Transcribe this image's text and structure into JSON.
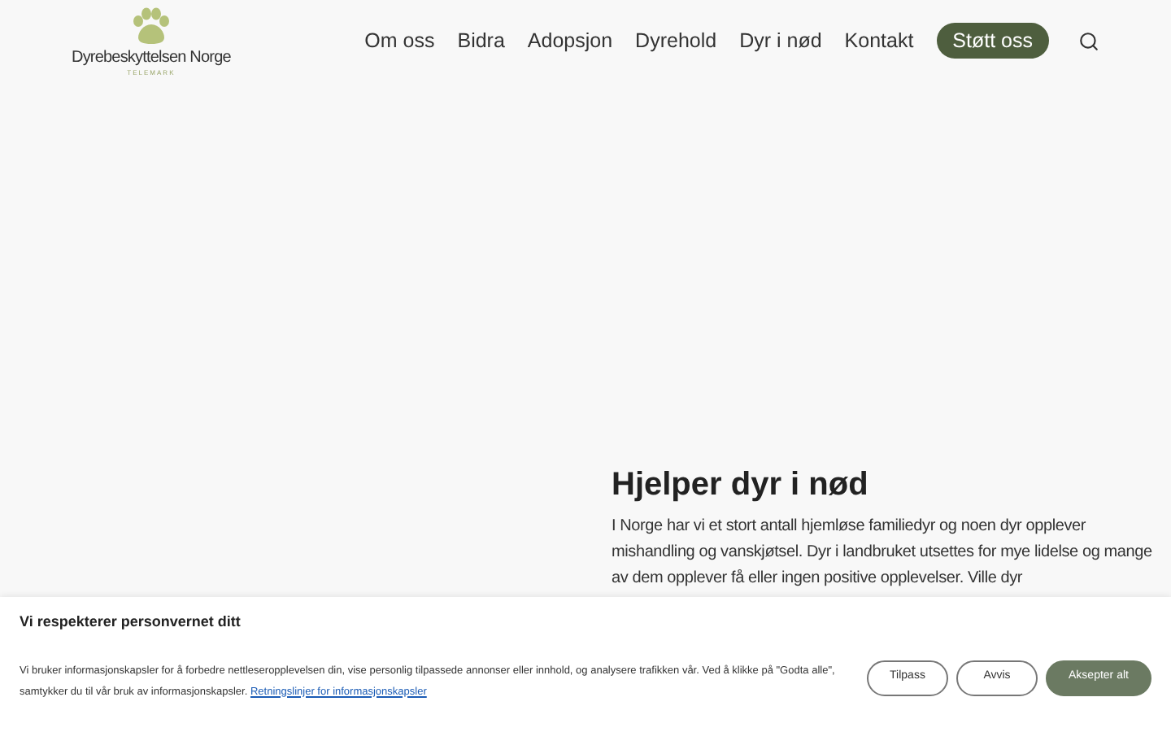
{
  "logo": {
    "name": "Dyrebeskyttelsen Norge",
    "region": "TELEMARK"
  },
  "nav": {
    "items": [
      {
        "label": "Om oss"
      },
      {
        "label": "Bidra"
      },
      {
        "label": "Adopsjon"
      },
      {
        "label": "Dyrehold"
      },
      {
        "label": "Dyr i nød"
      },
      {
        "label": "Kontakt"
      }
    ],
    "cta": "Støtt oss"
  },
  "hero": {
    "heading": "Hjelper dyr i nød",
    "text": "I Norge har vi et stort antall hjemløse familiedyr og noen dyr opplever mishandling og vanskjøtsel. Dyr i landbruket utsettes for mye lidelse og mange av dem opplever få eller ingen positive opplevelser. Ville dyr"
  },
  "cookie_banner": {
    "title": "Vi respekterer personvernet ditt",
    "text": "Vi bruker informasjonskapsler for å forbedre nettleseropplevelsen din, vise personlig tilpassede annonser eller innhold, og analysere trafikken vår. Ved å klikke på \"Godta alle\", samtykker du til vår bruk av informasjonskapsler.",
    "link": "Retningslinjer for informasjonskapsler",
    "buttons": [
      {
        "label": "Tilpass",
        "kind": "outline"
      },
      {
        "label": "Avvis",
        "kind": "outline"
      },
      {
        "label": "Aksepter alt",
        "kind": "filled"
      }
    ]
  }
}
